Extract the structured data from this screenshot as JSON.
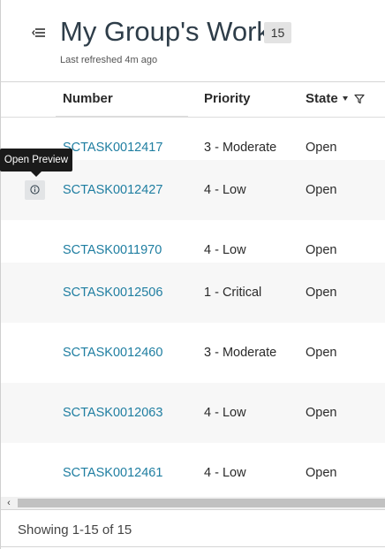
{
  "header": {
    "title": "My Group's Work",
    "count": "15",
    "last_refreshed": "Last refreshed 4m ago"
  },
  "table": {
    "columns": {
      "number": "Number",
      "priority": "Priority",
      "state": "State"
    },
    "rows": [
      {
        "number": "SCTASK0012417",
        "priority": "3 - Moderate",
        "state": "Open"
      },
      {
        "number": "SCTASK0012427",
        "priority": "4 - Low",
        "state": "Open"
      },
      {
        "number": "SCTASK0011970",
        "priority": "4 - Low",
        "state": "Open"
      },
      {
        "number": "SCTASK0012506",
        "priority": "1 - Critical",
        "state": "Open"
      },
      {
        "number": "SCTASK0012460",
        "priority": "3 - Moderate",
        "state": "Open"
      },
      {
        "number": "SCTASK0012063",
        "priority": "4 - Low",
        "state": "Open"
      },
      {
        "number": "SCTASK0012461",
        "priority": "4 - Low",
        "state": "Open"
      }
    ]
  },
  "tooltip": {
    "text": "Open Preview"
  },
  "footer": {
    "showing": "Showing 1-15 of 15"
  },
  "icons": {
    "collapse": "collapse-list-icon",
    "sort": "sort-caret-icon",
    "filter": "filter-icon",
    "preview": "info-circle-icon",
    "scroll_left": "scroll-left-arrow-icon"
  },
  "colors": {
    "link": "#1f7ea1",
    "title": "#2e3d49",
    "alt_row": "#f7f7f7"
  }
}
